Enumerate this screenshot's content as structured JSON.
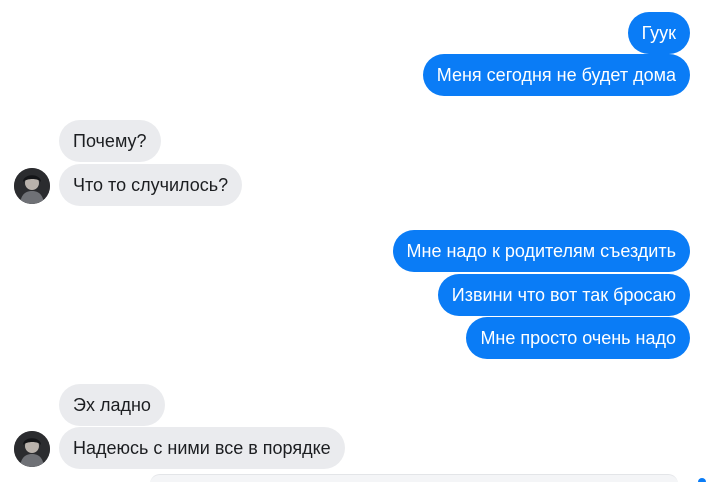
{
  "chat": {
    "messages": [
      {
        "side": "out",
        "text": "Гуук"
      },
      {
        "side": "out",
        "text": "Меня сегодня не будет дома"
      },
      {
        "side": "in",
        "text": "Почему?"
      },
      {
        "side": "in",
        "text": "Что то случилось?"
      },
      {
        "side": "out",
        "text": "Мне надо к родителям съездить"
      },
      {
        "side": "out",
        "text": "Извини что вот так бросаю"
      },
      {
        "side": "out",
        "text": "Мне просто очень надо"
      },
      {
        "side": "in",
        "text": "Эх ладно"
      },
      {
        "side": "in",
        "text": "Надеюсь с ними все в порядке"
      }
    ]
  },
  "colors": {
    "outgoing_bubble": "#0a7cf6",
    "incoming_bubble": "#eaebee",
    "outgoing_text": "#ffffff",
    "incoming_text": "#1c1e21"
  },
  "icons": {
    "contact_avatar": "user-avatar-icon"
  }
}
